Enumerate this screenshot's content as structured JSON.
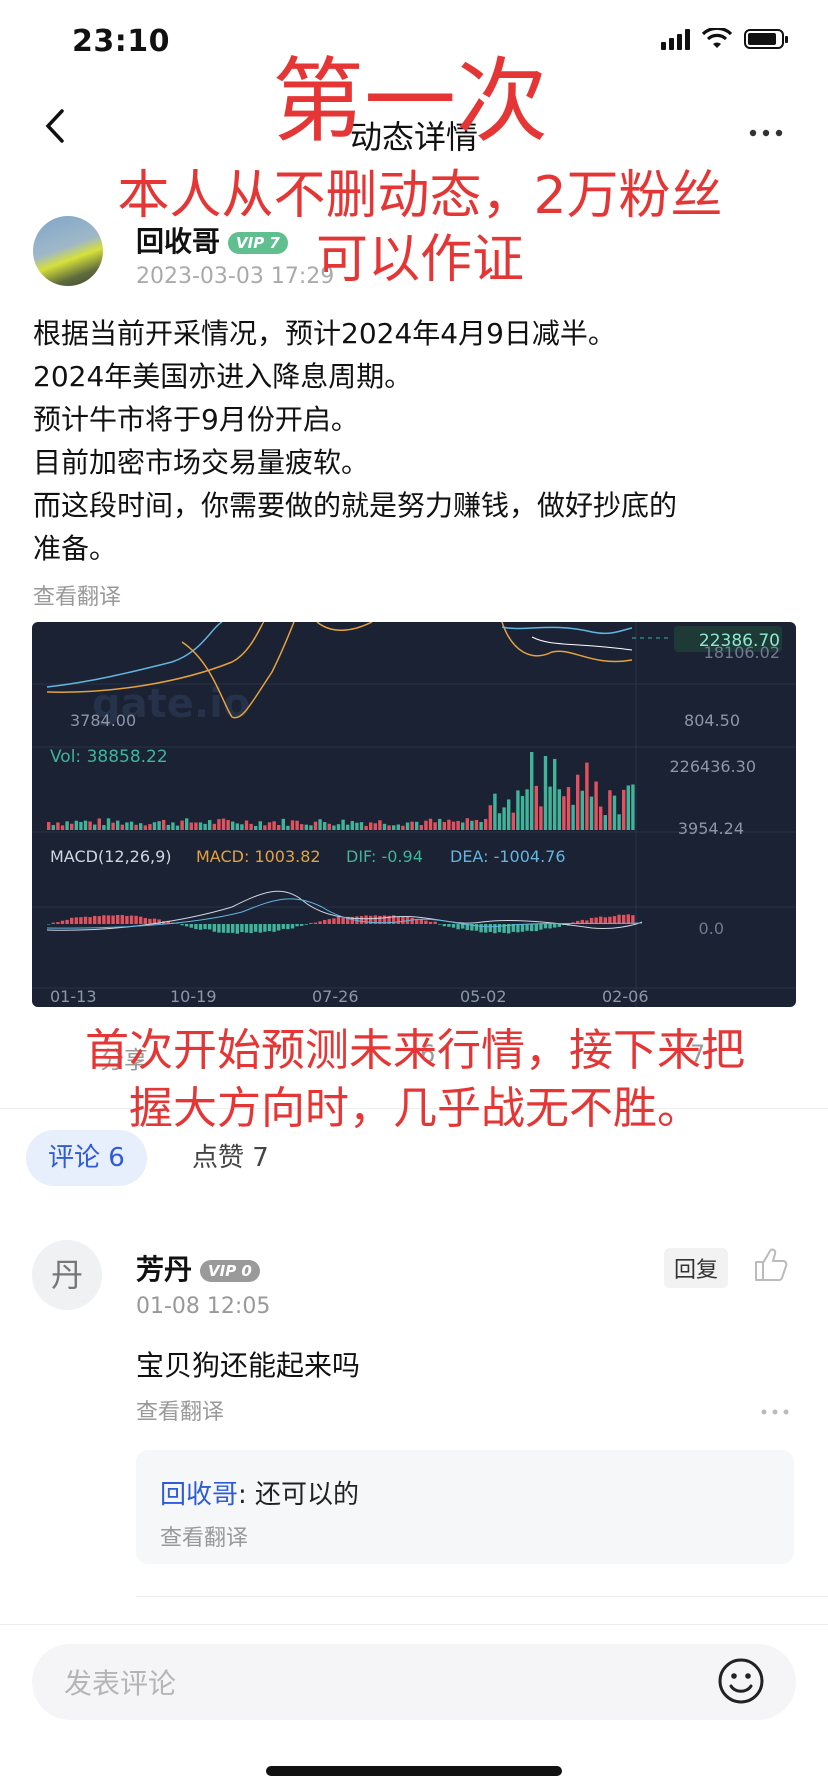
{
  "status_bar": {
    "time": "23:10"
  },
  "nav": {
    "back_icon": "chevron-left-icon",
    "title": "动态详情",
    "more_icon": "more-dots-icon"
  },
  "author": {
    "name": "回收哥",
    "vip": "VIP 7",
    "date": "2023-03-03 17:29"
  },
  "post": {
    "lines": [
      "根据当前开采情况，预计2024年4月9日减半。",
      "2024年美国亦进入降息周期。",
      "预计牛市将于9月份开启。",
      "目前加密市场交易量疲软。",
      "而这段时间，你需要做的就是努力赚钱，做好抄底的",
      "准备。"
    ],
    "translate_label": "查看翻译"
  },
  "chart_data": {
    "type": "line",
    "price_labels": {
      "current": "22386.70",
      "top_right": "18106.02",
      "mid_right": "804.50",
      "low": "3784.00"
    },
    "volume": {
      "label": "Vol: 38858.22",
      "right_top": "226436.30",
      "right_bottom": "3954.24"
    },
    "macd": {
      "label": "MACD(12,26,9)",
      "macd_value": "MACD: 1003.82",
      "dif_value": "DIF: -0.94",
      "dea_value": "DEA: -1004.76",
      "zero_label": "0.0"
    },
    "x_ticks": [
      "01-13",
      "10-19",
      "07-26",
      "05-02",
      "02-06"
    ],
    "watermark": "gate.io",
    "colors": {
      "background": "#1a2233",
      "up": "#3fb49a",
      "down": "#e2525e",
      "ma_blue": "#63b5e0",
      "ma_orange": "#e5a23d"
    }
  },
  "post_actions": {
    "share": "分享",
    "comments": "6",
    "likes": "7"
  },
  "tabs": {
    "comments": "评论 6",
    "likes": "点赞 7"
  },
  "comment": {
    "avatar_char": "丹",
    "name": "芳丹",
    "vip": "VIP 0",
    "date": "01-08 12:05",
    "text": "宝贝狗还能起来吗",
    "translate_label": "查看翻译",
    "reply_button": "回复",
    "reply": {
      "author": "回收哥",
      "text": ": 还可以的",
      "translate_label": "查看翻译"
    }
  },
  "input": {
    "placeholder": "发表评论"
  },
  "overlay": {
    "title": "第一次",
    "line1": "本人从不删动态，2万粉丝",
    "line2": "可以作证",
    "bottom1": "首次开始预测未来行情，接下来把",
    "bottom2": "握大方向时，几乎战无不胜。"
  },
  "colors": {
    "accent_blue": "#2e5bd8",
    "overlay_red": "#e53635",
    "vip_green": "#5fbf8e"
  }
}
